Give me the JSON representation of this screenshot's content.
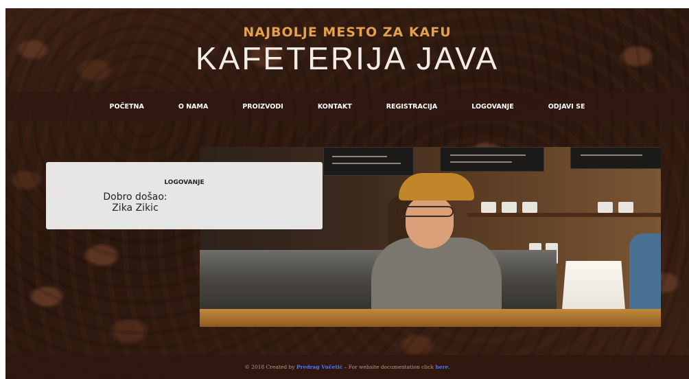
{
  "header": {
    "tagline": "NAJBOLJE MESTO ZA KAFU",
    "site_title": "KAFETERIJA JAVA"
  },
  "nav": {
    "items": [
      {
        "label": "POČETNA"
      },
      {
        "label": "O NAMA"
      },
      {
        "label": "PROIZVODI"
      },
      {
        "label": "KONTAKT"
      },
      {
        "label": "REGISTRACIJA"
      },
      {
        "label": "LOGOVANJE"
      },
      {
        "label": "ODJAVI SE"
      }
    ]
  },
  "login": {
    "title": "LOGOVANJE",
    "welcome": "Dobro došao:",
    "user_name": "Zika Zikic"
  },
  "footer": {
    "prefix": "© 2018 Created by ",
    "author": "Predrag Vučetić",
    "middle": " – For website documentation click ",
    "link": "here",
    "suffix": "."
  }
}
